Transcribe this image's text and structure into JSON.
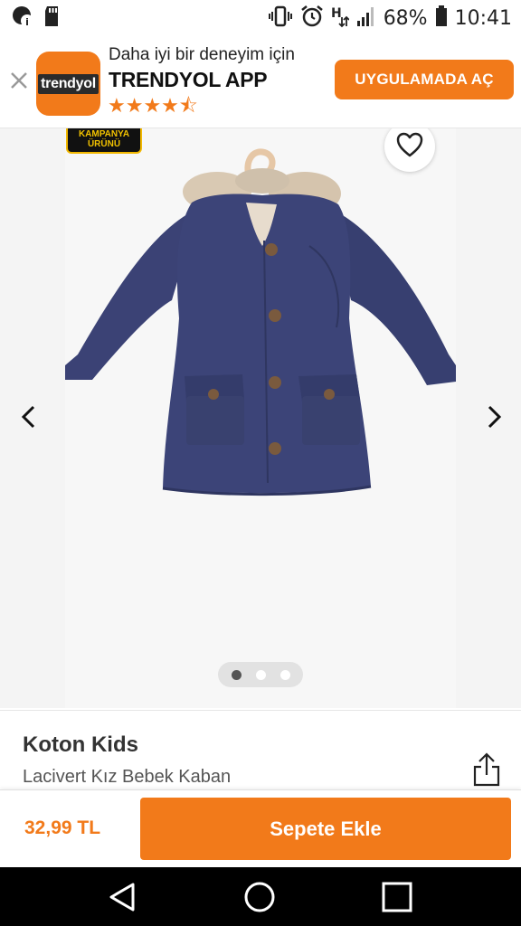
{
  "status_bar": {
    "battery": "68%",
    "time": "10:41",
    "icons": [
      "app-notification-icon",
      "sd-card-icon",
      "vibrate-icon",
      "alarm-icon",
      "data-icon",
      "signal-icon",
      "battery-icon"
    ]
  },
  "app_banner": {
    "tagline": "Daha iyi bir deneyim için",
    "app_name": "TRENDYOL APP",
    "logo_text": "trendyol",
    "rating_stars": "★★★★⯪",
    "rating": 4.5,
    "open_button": "UYGULAMADA AÇ",
    "close_icon": "close-icon"
  },
  "gallery": {
    "campaign_badge_line1": "KAMPANYA",
    "campaign_badge_line2": "ÜRÜNÜ",
    "image_description_icon": "navy-coat-image",
    "dot_count": 3,
    "active_dot": 0
  },
  "product": {
    "brand": "Koton Kids",
    "name": "Lacivert Kız Bebek Kaban"
  },
  "buy_bar": {
    "price": "32,99 TL",
    "add_to_cart": "Sepete Ekle"
  },
  "colors": {
    "accent": "#f27a1a",
    "coat": "#3b4275"
  }
}
